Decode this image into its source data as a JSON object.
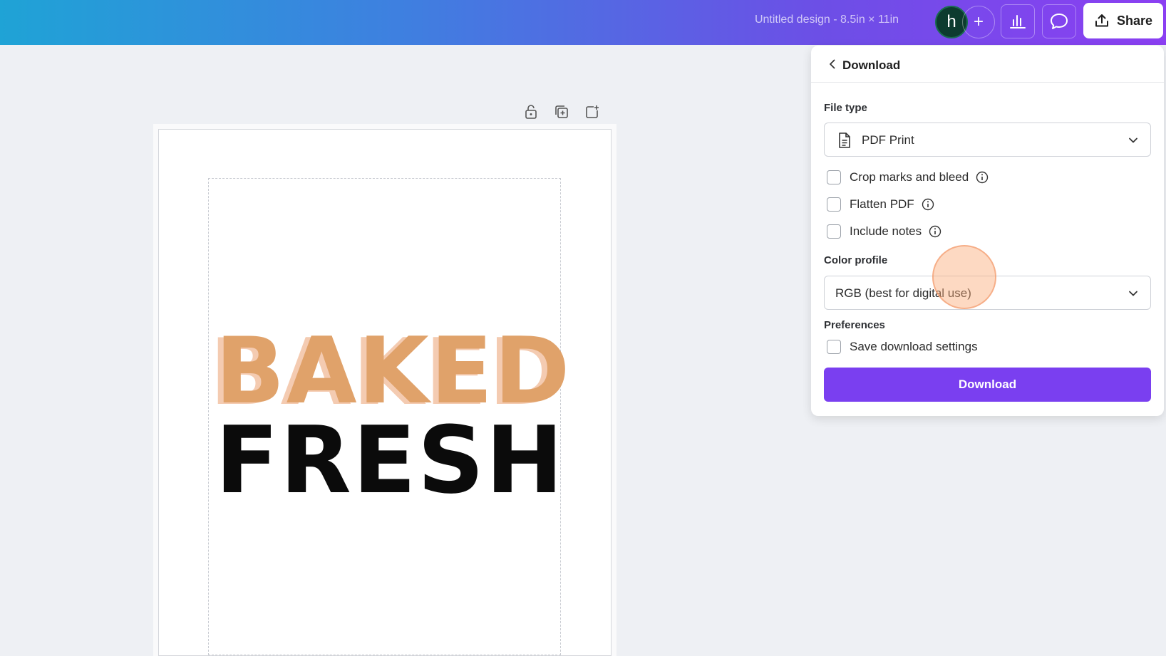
{
  "topbar": {
    "doc_title": "Untitled design - 8.5in × 11in",
    "avatar_letter": "h",
    "plus_label": "+",
    "share_label": "Share"
  },
  "design": {
    "line1": "BAKED",
    "line2": "FRESH"
  },
  "download_panel": {
    "title": "Download",
    "file_type_label": "File type",
    "file_type_value": "PDF Print",
    "options": [
      {
        "label": "Crop marks and bleed",
        "checked": false
      },
      {
        "label": "Flatten PDF",
        "checked": false
      },
      {
        "label": "Include notes",
        "checked": false
      }
    ],
    "color_profile_label": "Color profile",
    "color_profile_value": "RGB (best for digital use)",
    "preferences_label": "Preferences",
    "save_settings_label": "Save download settings",
    "download_button": "Download"
  },
  "colors": {
    "accent": "#7a3ff0",
    "baked": "#e0a26a",
    "fresh": "#0b0b0b"
  }
}
